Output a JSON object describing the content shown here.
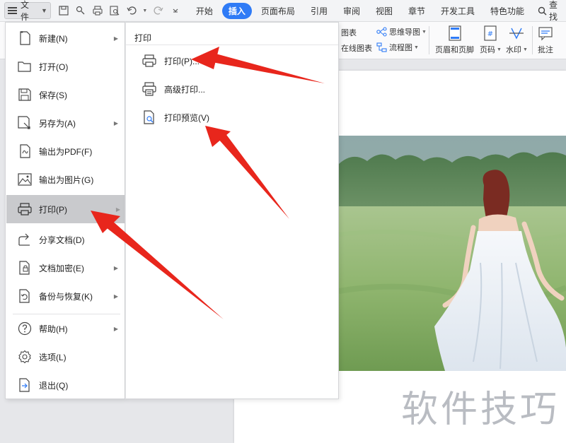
{
  "toolbar": {
    "file_label": "文件",
    "tabs": [
      "开始",
      "插入",
      "页面布局",
      "引用",
      "审阅",
      "视图",
      "章节",
      "开发工具",
      "特色功能"
    ],
    "active_tab": "插入",
    "search_label": "查找"
  },
  "ribbon": {
    "chart_label": "图表",
    "online_chart_label": "在线图表",
    "mindmap_label": "思维导图",
    "flowchart_label": "流程图",
    "header_footer_label": "页眉和页脚",
    "page_number_label": "页码",
    "watermark_label": "水印",
    "comment_label": "批注"
  },
  "file_menu": {
    "items": [
      {
        "label": "新建(N)",
        "icon": "new-doc-icon",
        "submenu": true
      },
      {
        "label": "打开(O)",
        "icon": "open-folder-icon",
        "submenu": false
      },
      {
        "label": "保存(S)",
        "icon": "save-icon",
        "submenu": false
      },
      {
        "label": "另存为(A)",
        "icon": "save-as-icon",
        "submenu": true
      },
      {
        "label": "输出为PDF(F)",
        "icon": "export-pdf-icon",
        "submenu": false
      },
      {
        "label": "输出为图片(G)",
        "icon": "export-image-icon",
        "submenu": false
      },
      {
        "label": "打印(P)",
        "icon": "printer-icon",
        "submenu": true,
        "active": true
      },
      {
        "label": "分享文档(D)",
        "icon": "share-icon",
        "submenu": false
      },
      {
        "label": "文档加密(E)",
        "icon": "encrypt-icon",
        "submenu": true
      },
      {
        "label": "备份与恢复(K)",
        "icon": "backup-icon",
        "submenu": true
      },
      {
        "label": "帮助(H)",
        "icon": "help-icon",
        "submenu": true
      },
      {
        "label": "选项(L)",
        "icon": "gear-icon",
        "submenu": false
      },
      {
        "label": "退出(Q)",
        "icon": "exit-icon",
        "submenu": false
      }
    ]
  },
  "print_submenu": {
    "title": "打印",
    "items": [
      {
        "label": "打印(P)...",
        "icon": "printer-icon"
      },
      {
        "label": "高级打印...",
        "icon": "advanced-print-icon"
      },
      {
        "label": "打印预览(V)",
        "icon": "print-preview-icon"
      }
    ]
  },
  "document": {
    "watermark_text": "软件技巧"
  },
  "colors": {
    "accent": "#2f7bf6",
    "annotation_arrow": "#e8261c",
    "active_menu_bg": "#c9cacd"
  }
}
